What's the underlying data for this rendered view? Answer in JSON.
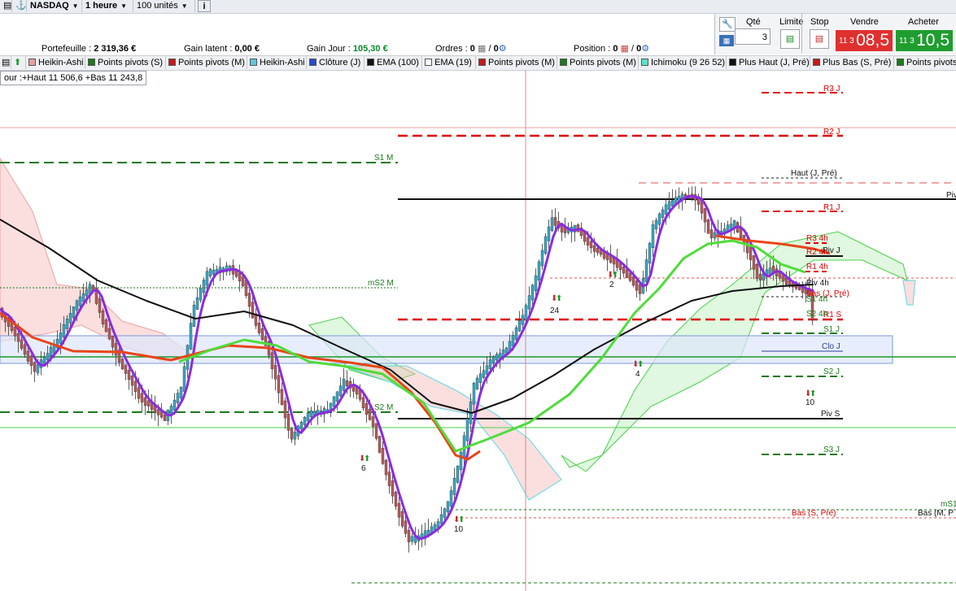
{
  "toolbar": {
    "instrument": "NASDAQ",
    "timeframe": "1 heure",
    "units": "100 unités",
    "info_glyph": "i"
  },
  "info": {
    "portefeuille_label": "Portefeuille :",
    "portefeuille_value": "2 319,36 €",
    "gain_latent_label": "Gain latent :",
    "gain_latent_value": "0,00 €",
    "gain_jour_label": "Gain Jour :",
    "gain_jour_value": "105,30 €",
    "ordres_label": "Ordres :",
    "ordres_a": "0",
    "ordres_b": "0",
    "position_label": "Position :",
    "position_a": "0",
    "position_b": "0"
  },
  "trade": {
    "qte_label": "Qté",
    "qty": "3",
    "limite_label": "Limite",
    "stop_label": "Stop",
    "vendre_label": "Vendre",
    "acheter_label": "Acheter",
    "sell_small": "11 3",
    "sell_big": "08,5",
    "buy_small": "11 3",
    "buy_big": "10,5"
  },
  "indicators": [
    "Heikin-Ashi",
    "Points pivots (S)",
    "Points pivots (M)",
    "Heikin-Ashi",
    "Clôture (J)",
    "EMA (100)",
    "EMA (19)",
    "Points pivots (M)",
    "Points pivots (M)",
    "Ichimoku (9 26 52)",
    "Plus Haut (J, Pré)",
    "Plus Bas (S, Pré)",
    "Points pivots"
  ],
  "ohlc": "our :+Haut 11 506,6 +Bas 11 243,8",
  "levels": {
    "r3j": "R3 J",
    "r2j": "R2 J",
    "s1m": "S1 M",
    "hautj": "Haut (J, Pré)",
    "piv": "Piv",
    "r1j": "R1 J",
    "r34h": "R3 4h",
    "r24h": "R2 4h",
    "pivj": "Piv J",
    "r14h": "R1 4h",
    "ms2m": "mS2 M",
    "piv4h": "Piv 4h",
    "basj": "Bas (J, Pré)",
    "s14h": "S1 4h",
    "r1s": "R1 S",
    "s24h": "S2 4h",
    "s1j": "S1 J",
    "cloj": "Clo J",
    "s2j": "S2 J",
    "s2m": "S2 M",
    "pivs": "Piv S",
    "s3j": "S3 J",
    "ms1": "mS1",
    "bass": "Bas (S, Pré)",
    "basm": "Bas (M, P"
  },
  "markers": {
    "m24": "24",
    "m2": "2",
    "m4": "4",
    "m6": "6",
    "m10a": "10",
    "m10b": "10"
  },
  "colors": {
    "up": "#36a9c7",
    "down": "#b85a5a",
    "ema19": "#8a2be2",
    "ema100": "#111111",
    "tenkan": "#e84418",
    "kijun": "#4fdc3a",
    "pivot_red": "#e00000",
    "pivot_green": "#1a7a1a"
  }
}
